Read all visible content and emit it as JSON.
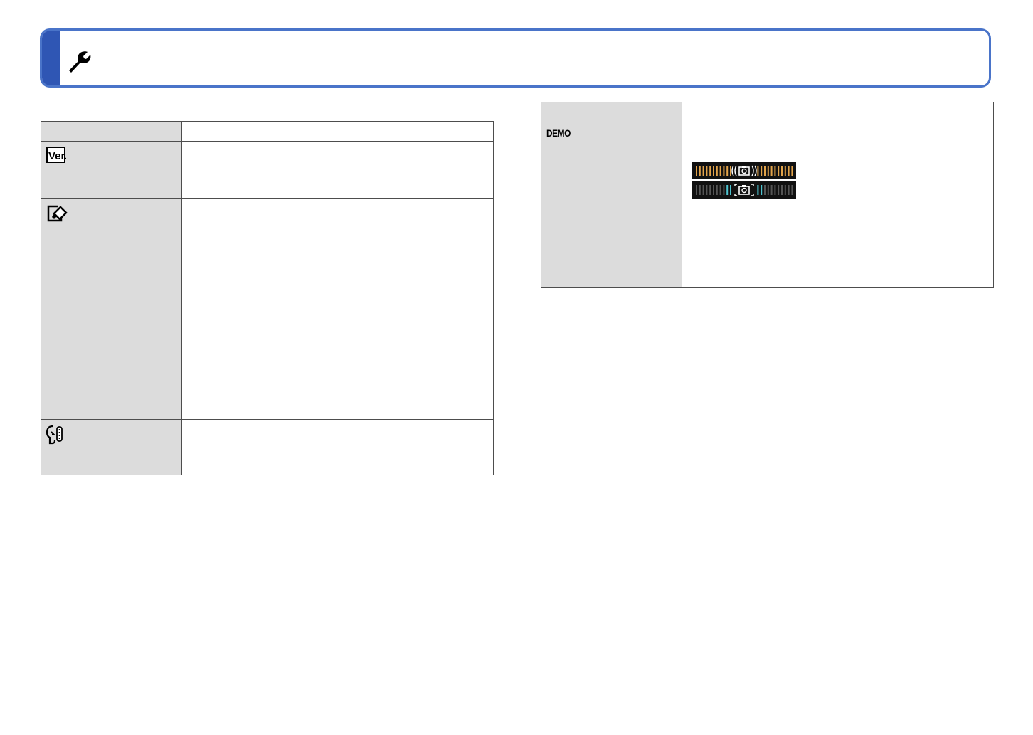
{
  "header": {
    "icon": "wrench-icon",
    "accent_color": "#2f56b4",
    "border_color": "#4a74c9"
  },
  "left_table": {
    "rows": [
      {
        "icon": "version-display-icon",
        "label": "Ver."
      },
      {
        "icon": "reset-icon"
      },
      {
        "icon": "sound-icon"
      }
    ]
  },
  "right_table": {
    "rows": [
      {
        "label": "DEMO",
        "bars": [
          "shake-indicator-orange",
          "shake-indicator-cyan"
        ]
      }
    ]
  },
  "colors": {
    "label_bg": "#dcdcdc",
    "bar_orange": "#e3a44a",
    "bar_cyan": "#4ec3cf",
    "bar_gray": "#555555"
  }
}
